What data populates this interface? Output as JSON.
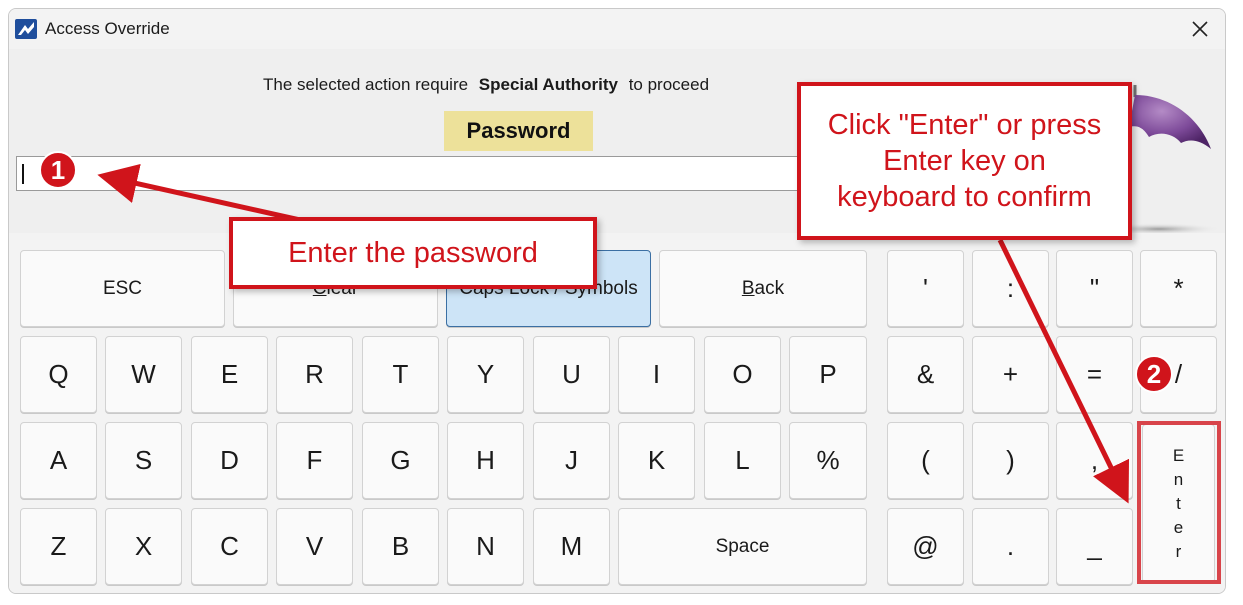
{
  "window": {
    "title": "Access Override",
    "close_glyph": "✕"
  },
  "prompt": {
    "before": "The selected action require",
    "bold": "Special Authority",
    "after": "to proceed"
  },
  "password": {
    "label": "Password",
    "value": ""
  },
  "keyboard": {
    "row0": [
      "ESC",
      "Clear",
      "Caps Lock / Symbols",
      "Back"
    ],
    "row1": [
      "Q",
      "W",
      "E",
      "R",
      "T",
      "Y",
      "U",
      "I",
      "O",
      "P"
    ],
    "row2": [
      "A",
      "S",
      "D",
      "F",
      "G",
      "H",
      "J",
      "K",
      "L",
      "%"
    ],
    "row3": [
      "Z",
      "X",
      "C",
      "V",
      "B",
      "N",
      "M"
    ],
    "space": "Space",
    "sym0": [
      "'",
      ":",
      "\"",
      "*"
    ],
    "sym1": [
      "&",
      "+",
      "=",
      "/"
    ],
    "sym2": [
      "(",
      ")",
      ","
    ],
    "sym3": [
      "@",
      ".",
      "_"
    ],
    "enter_letters": [
      "E",
      "n",
      "t",
      "e",
      "r"
    ]
  },
  "annotations": {
    "step1_badge": "1",
    "step1_text": "Enter the password",
    "step2_badge": "2",
    "step2_text_lines": [
      "Click \"Enter\" or press",
      "Enter key on",
      "keyboard to confirm"
    ],
    "accent": "#d0141b"
  },
  "icons": {
    "app": "app-logo-icon",
    "close": "close-icon",
    "umbrella": "umbrella-logo-icon"
  }
}
